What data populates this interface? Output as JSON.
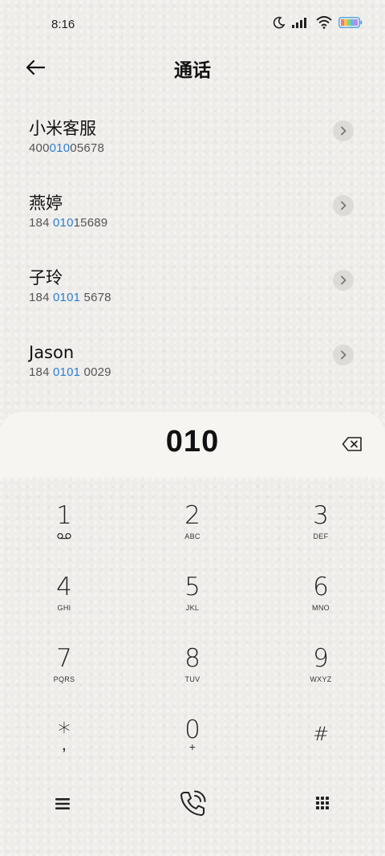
{
  "status_bar": {
    "time": "8:16",
    "icons": [
      "moon-icon",
      "signal-icon",
      "wifi-icon",
      "battery-icon"
    ]
  },
  "header": {
    "title": "通话",
    "back_icon": "back-arrow-icon"
  },
  "contacts": [
    {
      "name": "小米客服",
      "number_pre": "400",
      "number_match": "010",
      "number_post": "05678"
    },
    {
      "name": "燕婷",
      "number_pre": "184 ",
      "number_match": "010",
      "number_post": "15689"
    },
    {
      "name": "子玲",
      "number_pre": "184 ",
      "number_match": "0101",
      "number_post": " 5678"
    },
    {
      "name": "Jason",
      "number_pre": "184 ",
      "number_match": "0101",
      "number_post": " 0029"
    }
  ],
  "dialpad": {
    "entered": "010",
    "keys": [
      {
        "digit": "1",
        "letters": ""
      },
      {
        "digit": "2",
        "letters": "ABC"
      },
      {
        "digit": "3",
        "letters": "DEF"
      },
      {
        "digit": "4",
        "letters": "GHI"
      },
      {
        "digit": "5",
        "letters": "JKL"
      },
      {
        "digit": "6",
        "letters": "MNO"
      },
      {
        "digit": "7",
        "letters": "PQRS"
      },
      {
        "digit": "8",
        "letters": "TUV"
      },
      {
        "digit": "9",
        "letters": "WXYZ"
      },
      {
        "digit": "*",
        "letters": ","
      },
      {
        "digit": "0",
        "letters": "+"
      },
      {
        "digit": "#",
        "letters": ""
      }
    ]
  },
  "colors": {
    "highlight": "#2b7fd3",
    "background": "#efedea",
    "panel": "#f6f5f1"
  }
}
